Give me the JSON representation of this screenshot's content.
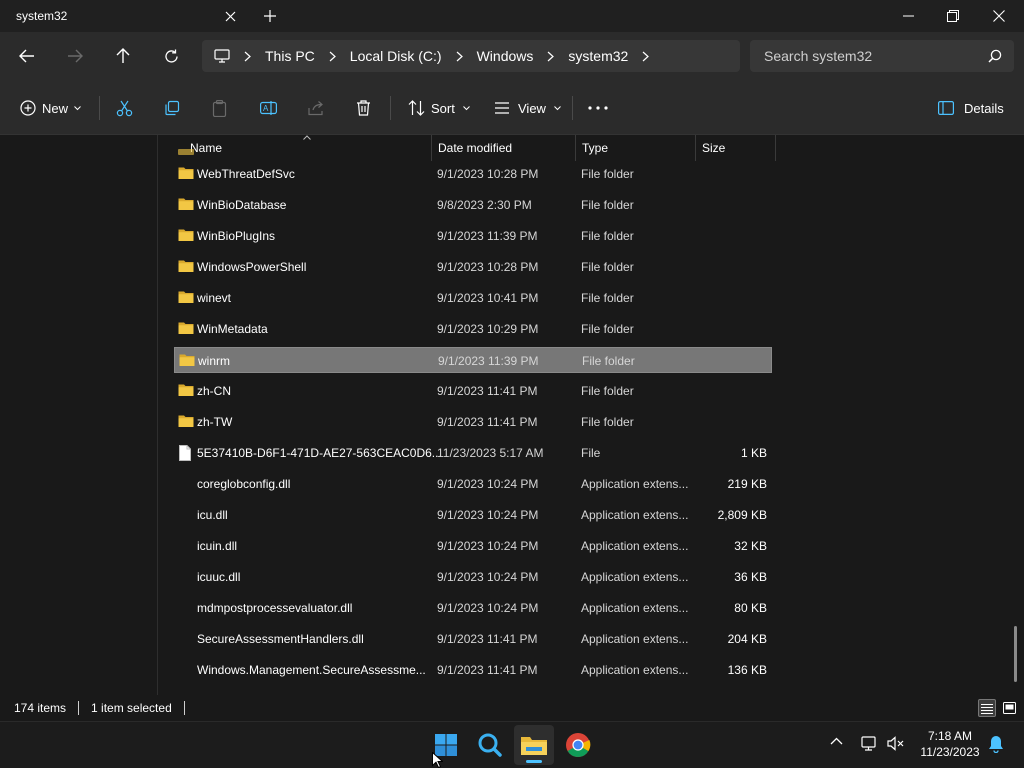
{
  "window": {
    "tab_title": "system32"
  },
  "address": {
    "crumbs": [
      "This PC",
      "Local Disk (C:)",
      "Windows",
      "system32"
    ],
    "search_placeholder": "Search system32"
  },
  "commands": {
    "new_label": "New",
    "sort_label": "Sort",
    "view_label": "View",
    "details_label": "Details"
  },
  "columns": {
    "name": "Name",
    "date": "Date modified",
    "type": "Type",
    "size": "Size"
  },
  "files": [
    {
      "name": "WebThreatDefSvc",
      "date": "9/1/2023 10:28 PM",
      "type": "File folder",
      "size": "",
      "icon": "folder-icon",
      "selected": false
    },
    {
      "name": "WinBioDatabase",
      "date": "9/8/2023 2:30 PM",
      "type": "File folder",
      "size": "",
      "icon": "folder-icon",
      "selected": false
    },
    {
      "name": "WinBioPlugIns",
      "date": "9/1/2023 11:39 PM",
      "type": "File folder",
      "size": "",
      "icon": "folder-icon",
      "selected": false
    },
    {
      "name": "WindowsPowerShell",
      "date": "9/1/2023 10:28 PM",
      "type": "File folder",
      "size": "",
      "icon": "folder-icon",
      "selected": false
    },
    {
      "name": "winevt",
      "date": "9/1/2023 10:41 PM",
      "type": "File folder",
      "size": "",
      "icon": "folder-icon",
      "selected": false
    },
    {
      "name": "WinMetadata",
      "date": "9/1/2023 10:29 PM",
      "type": "File folder",
      "size": "",
      "icon": "folder-icon",
      "selected": false
    },
    {
      "name": "winrm",
      "date": "9/1/2023 11:39 PM",
      "type": "File folder",
      "size": "",
      "icon": "folder-icon",
      "selected": true
    },
    {
      "name": "zh-CN",
      "date": "9/1/2023 11:41 PM",
      "type": "File folder",
      "size": "",
      "icon": "folder-icon",
      "selected": false
    },
    {
      "name": "zh-TW",
      "date": "9/1/2023 11:41 PM",
      "type": "File folder",
      "size": "",
      "icon": "folder-icon",
      "selected": false
    },
    {
      "name": "5E37410B-D6F1-471D-AE27-563CEAC0D6...",
      "date": "11/23/2023 5:17 AM",
      "type": "File",
      "size": "1 KB",
      "icon": "file-icon",
      "selected": false
    },
    {
      "name": "coreglobconfig.dll",
      "date": "9/1/2023 10:24 PM",
      "type": "Application extens...",
      "size": "219 KB",
      "icon": "dll-icon",
      "selected": false
    },
    {
      "name": "icu.dll",
      "date": "9/1/2023 10:24 PM",
      "type": "Application extens...",
      "size": "2,809 KB",
      "icon": "dll-icon",
      "selected": false
    },
    {
      "name": "icuin.dll",
      "date": "9/1/2023 10:24 PM",
      "type": "Application extens...",
      "size": "32 KB",
      "icon": "dll-icon",
      "selected": false
    },
    {
      "name": "icuuc.dll",
      "date": "9/1/2023 10:24 PM",
      "type": "Application extens...",
      "size": "36 KB",
      "icon": "dll-icon",
      "selected": false
    },
    {
      "name": "mdmpostprocessevaluator.dll",
      "date": "9/1/2023 10:24 PM",
      "type": "Application extens...",
      "size": "80 KB",
      "icon": "dll-icon",
      "selected": false
    },
    {
      "name": "SecureAssessmentHandlers.dll",
      "date": "9/1/2023 11:41 PM",
      "type": "Application extens...",
      "size": "204 KB",
      "icon": "dll-icon",
      "selected": false
    },
    {
      "name": "Windows.Management.SecureAssessme...",
      "date": "9/1/2023 11:41 PM",
      "type": "Application extens...",
      "size": "136 KB",
      "icon": "dll-icon",
      "selected": false
    }
  ],
  "status": {
    "items_count": "174 items",
    "selection": "1 item selected"
  },
  "taskbar": {
    "time": "7:18 AM",
    "date": "11/23/2023",
    "apps": [
      "start-icon",
      "search-icon",
      "file-explorer-icon",
      "chrome-icon"
    ]
  },
  "colors": {
    "folder": "#f2c744",
    "accent": "#4cc2ff",
    "selected_row": "#777777"
  }
}
